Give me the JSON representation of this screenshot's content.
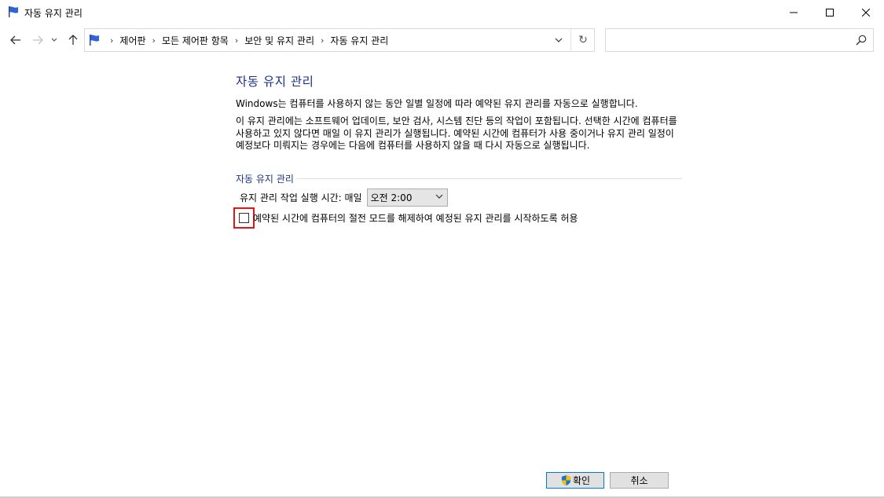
{
  "window": {
    "title": "자동 유지 관리",
    "icon": "flag-icon"
  },
  "navigation": {
    "back_icon": "arrow-left-icon",
    "forward_icon": "arrow-right-icon",
    "recent_icon": "chevron-down-icon",
    "up_icon": "arrow-up-icon"
  },
  "address": {
    "breadcrumbs": [
      "제어판",
      "모든 제어판 항목",
      "보안 및 유지 관리",
      "자동 유지 관리"
    ],
    "separator": "›",
    "refresh_glyph": "↻"
  },
  "search": {
    "value": "",
    "placeholder": ""
  },
  "main": {
    "title": "자동 유지 관리",
    "description1": "Windows는 컴퓨터를 사용하지 않는 동안 일별 일정에 따라 예약된 유지 관리를 자동으로 실행합니다.",
    "description2": "이 유지 관리에는 소프트웨어 업데이트, 보안 검사, 시스템 진단 등의 작업이 포함됩니다. 선택한 시간에 컴퓨터를 사용하고 있지 않다면 매일 이 유지 관리가 실행됩니다. 예약된 시간에 컴퓨터가 사용 중이거나 유지 관리 일정이 예정보다 미뤄지는 경우에는 다음에 컴퓨터를 사용하지 않을 때 다시 자동으로 실행됩니다.",
    "group_label": "자동 유지 관리",
    "schedule_label": "유지 관리 작업 실행 시간: 매일",
    "schedule_value": "오전 2:00",
    "wake_checkbox_label": "예약된 시간에 컴퓨터의 절전 모드를 해제하여 예정된 유지 관리를 시작하도록 허용",
    "wake_checkbox_checked": false
  },
  "footer": {
    "ok_label": "확인",
    "cancel_label": "취소"
  },
  "colors": {
    "title_blue": "#1e3287",
    "highlight_red": "#e01616",
    "button_focus": "#0078d7"
  }
}
